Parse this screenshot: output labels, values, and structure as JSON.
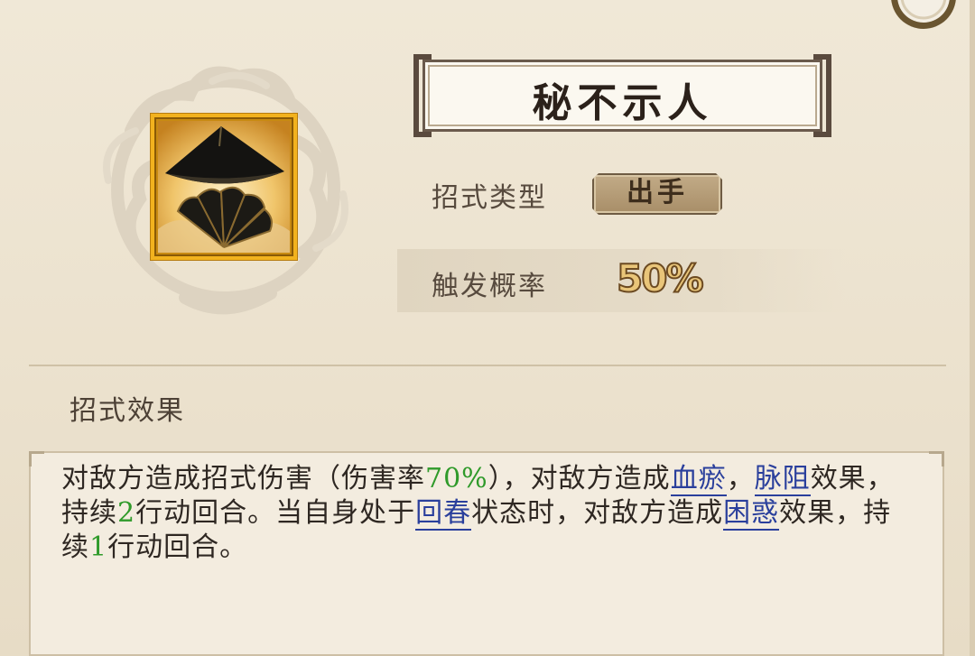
{
  "skill": {
    "name": "秘不示人",
    "icon": "hat-and-fan-icon"
  },
  "attributes": {
    "type_label": "招式类型",
    "type_value": "出手",
    "chance_label": "触发概率",
    "chance_value": "50%"
  },
  "effect": {
    "heading": "招式效果",
    "segments": [
      {
        "text": "对敌方造成招式伤害（伤害率",
        "style": "normal"
      },
      {
        "text": "70%",
        "style": "number"
      },
      {
        "text": "），对敌方造成",
        "style": "normal"
      },
      {
        "text": "血瘀",
        "style": "keyword"
      },
      {
        "text": "，",
        "style": "normal"
      },
      {
        "text": "脉阻",
        "style": "keyword"
      },
      {
        "text": "效果，持续",
        "style": "normal"
      },
      {
        "text": "2",
        "style": "number"
      },
      {
        "text": "行动回合。当自身处于",
        "style": "normal"
      },
      {
        "text": "回春",
        "style": "keyword"
      },
      {
        "text": "状态时，对敌方造成",
        "style": "normal"
      },
      {
        "text": "困惑",
        "style": "keyword"
      },
      {
        "text": "效果，持续",
        "style": "normal"
      },
      {
        "text": "1",
        "style": "number"
      },
      {
        "text": "行动回合。",
        "style": "normal"
      }
    ]
  },
  "colors": {
    "number": "#2f9a2a",
    "keyword": "#2a3f9c",
    "frame_gold": "#f2b21e"
  }
}
